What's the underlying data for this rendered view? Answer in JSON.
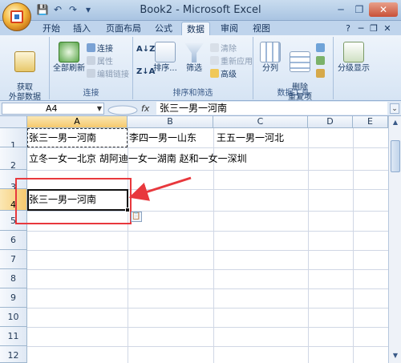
{
  "window": {
    "title": "Book2 - Microsoft Excel"
  },
  "qat": {
    "save": "💾",
    "undo": "↶",
    "redo": "↷",
    "more": "▾"
  },
  "window_controls": {
    "minimize": "─",
    "restore": "❐",
    "close": "✕"
  },
  "tabs": [
    {
      "label": "开始"
    },
    {
      "label": "插入"
    },
    {
      "label": "页面布局"
    },
    {
      "label": "公式"
    },
    {
      "label": "数据",
      "active": true
    },
    {
      "label": "审阅"
    },
    {
      "label": "视图"
    }
  ],
  "tab_right": {
    "help": "?",
    "minimize": "─",
    "restore": "❐",
    "close": "✕"
  },
  "ribbon": {
    "get_external": "获取\n外部数据",
    "refresh_all": "全部刷新",
    "connections": "连接",
    "properties": "属性",
    "edit_links": "编辑链接",
    "group_connections": "连接",
    "sort_asc": "A↓Z",
    "sort_desc": "Z↓A",
    "sort": "排序...",
    "filter": "筛选",
    "clear": "清除",
    "reapply": "重新应用",
    "advanced": "高级",
    "group_sort": "排序和筛选",
    "text_to_columns": "分列",
    "remove_duplicates": "删除\n重复项",
    "group_tools": "数据工具",
    "outline": "分级显示",
    "group_outline": ""
  },
  "formula_bar": {
    "name_box": "A4",
    "fx": "fx",
    "value": "张三一男一河南"
  },
  "columns": [
    "A",
    "B",
    "C",
    "D",
    "E"
  ],
  "rows": [
    "1",
    "2",
    "3",
    "4",
    "5",
    "6",
    "7",
    "8",
    "9",
    "10",
    "11",
    "12"
  ],
  "cells": {
    "A1": "张三一男一河南",
    "B1": "李四一男一山东",
    "C1": "王五一男一河北",
    "A2": "立冬一女一北京  胡阿迪一女一湖南  赵和一女一深圳",
    "A4": "张三一男一河南"
  },
  "colors": {
    "highlight_red": "#e8383d",
    "ribbon_tab_active": "#eef4fb"
  }
}
